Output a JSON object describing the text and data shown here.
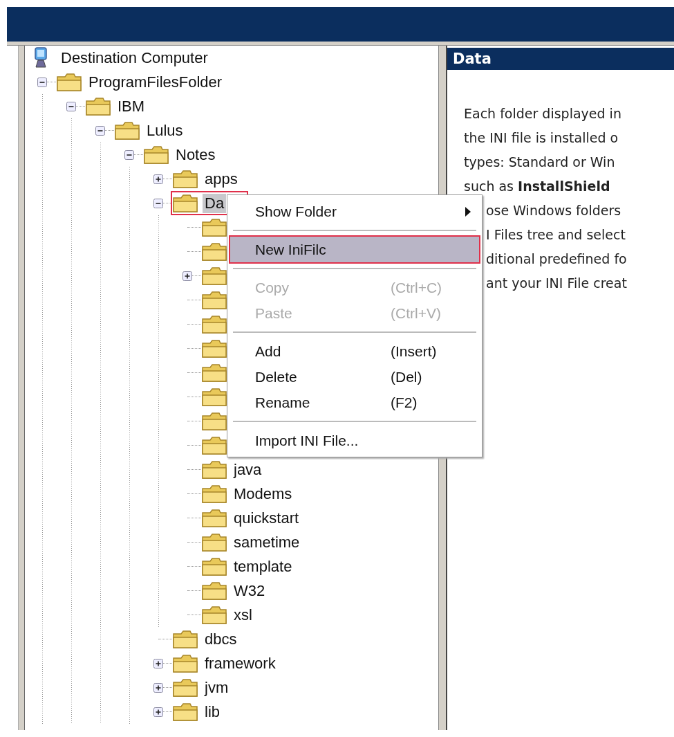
{
  "tree": {
    "root": {
      "label": "Destination Computer",
      "kind": "computer",
      "children": [
        {
          "label": "ProgramFilesFolder",
          "kind": "folder",
          "expanded": true,
          "children": [
            {
              "label": "IBM",
              "kind": "folder",
              "expanded": true,
              "children": [
                {
                  "label": "Lulus",
                  "kind": "folder",
                  "expanded": true,
                  "children": [
                    {
                      "label": "Notes",
                      "kind": "folder",
                      "expanded": true,
                      "children": [
                        {
                          "label": "apps",
                          "kind": "folder",
                          "expanded": false
                        },
                        {
                          "label": "Da",
                          "kind": "folder",
                          "expanded": true,
                          "selected": true,
                          "callout": true,
                          "children": [
                            {
                              "kind": "folder"
                            },
                            {
                              "kind": "folder"
                            },
                            {
                              "kind": "folder",
                              "expanded": false
                            },
                            {
                              "kind": "folder"
                            },
                            {
                              "kind": "folder"
                            },
                            {
                              "kind": "folder"
                            },
                            {
                              "kind": "folder"
                            },
                            {
                              "kind": "folder"
                            },
                            {
                              "kind": "folder"
                            },
                            {
                              "kind": "folder"
                            },
                            {
                              "label": "java",
                              "kind": "folder"
                            },
                            {
                              "label": "Modems",
                              "kind": "folder"
                            },
                            {
                              "label": "quickstart",
                              "kind": "folder"
                            },
                            {
                              "label": "sametime",
                              "kind": "folder"
                            },
                            {
                              "label": "template",
                              "kind": "folder"
                            },
                            {
                              "label": "W32",
                              "kind": "folder"
                            },
                            {
                              "label": "xsl",
                              "kind": "folder"
                            }
                          ]
                        },
                        {
                          "label": "dbcs",
                          "kind": "folder"
                        },
                        {
                          "label": "framework",
                          "kind": "folder",
                          "expanded": false
                        },
                        {
                          "label": "jvm",
                          "kind": "folder",
                          "expanded": false
                        },
                        {
                          "label": "lib",
                          "kind": "folder",
                          "expanded": false
                        }
                      ]
                    }
                  ]
                }
              ]
            }
          ]
        }
      ]
    }
  },
  "info_panel": {
    "title": "Data",
    "lines": [
      "Each folder displayed in",
      "the INI file is installed o",
      "types: Standard or Win",
      "such as **InstallShield**"
    ],
    "lines_beside_menu": [
      "ose Windows folders",
      "I Files tree and select",
      "ditional predefined fo",
      "ant your INI File creat"
    ]
  },
  "context_menu": {
    "items": [
      {
        "kind": "item",
        "label": "Show Folder",
        "submenu": true,
        "disabled": false,
        "selected": false,
        "callout": false
      },
      {
        "kind": "separator"
      },
      {
        "kind": "item",
        "label": "New IniFilc",
        "disabled": false,
        "selected": true,
        "callout": true
      },
      {
        "kind": "separator"
      },
      {
        "kind": "item",
        "label": "Copy",
        "shortcut": "(Ctrl+C)",
        "disabled": true,
        "selected": false,
        "callout": false
      },
      {
        "kind": "item",
        "label": "Paste",
        "shortcut": "(Ctrl+V)",
        "disabled": true,
        "selected": false,
        "callout": false
      },
      {
        "kind": "separator"
      },
      {
        "kind": "item",
        "label": "Add",
        "shortcut": "(Insert)",
        "disabled": false,
        "selected": false,
        "callout": false
      },
      {
        "kind": "item",
        "label": "Delete",
        "shortcut": "(Del)",
        "disabled": false,
        "selected": false,
        "callout": false
      },
      {
        "kind": "item",
        "label": "Rename",
        "shortcut": "(F2)",
        "disabled": false,
        "selected": false,
        "callout": false
      },
      {
        "kind": "separator"
      },
      {
        "kind": "item",
        "label": "Import INI File...",
        "disabled": false,
        "selected": false,
        "callout": false
      }
    ]
  }
}
